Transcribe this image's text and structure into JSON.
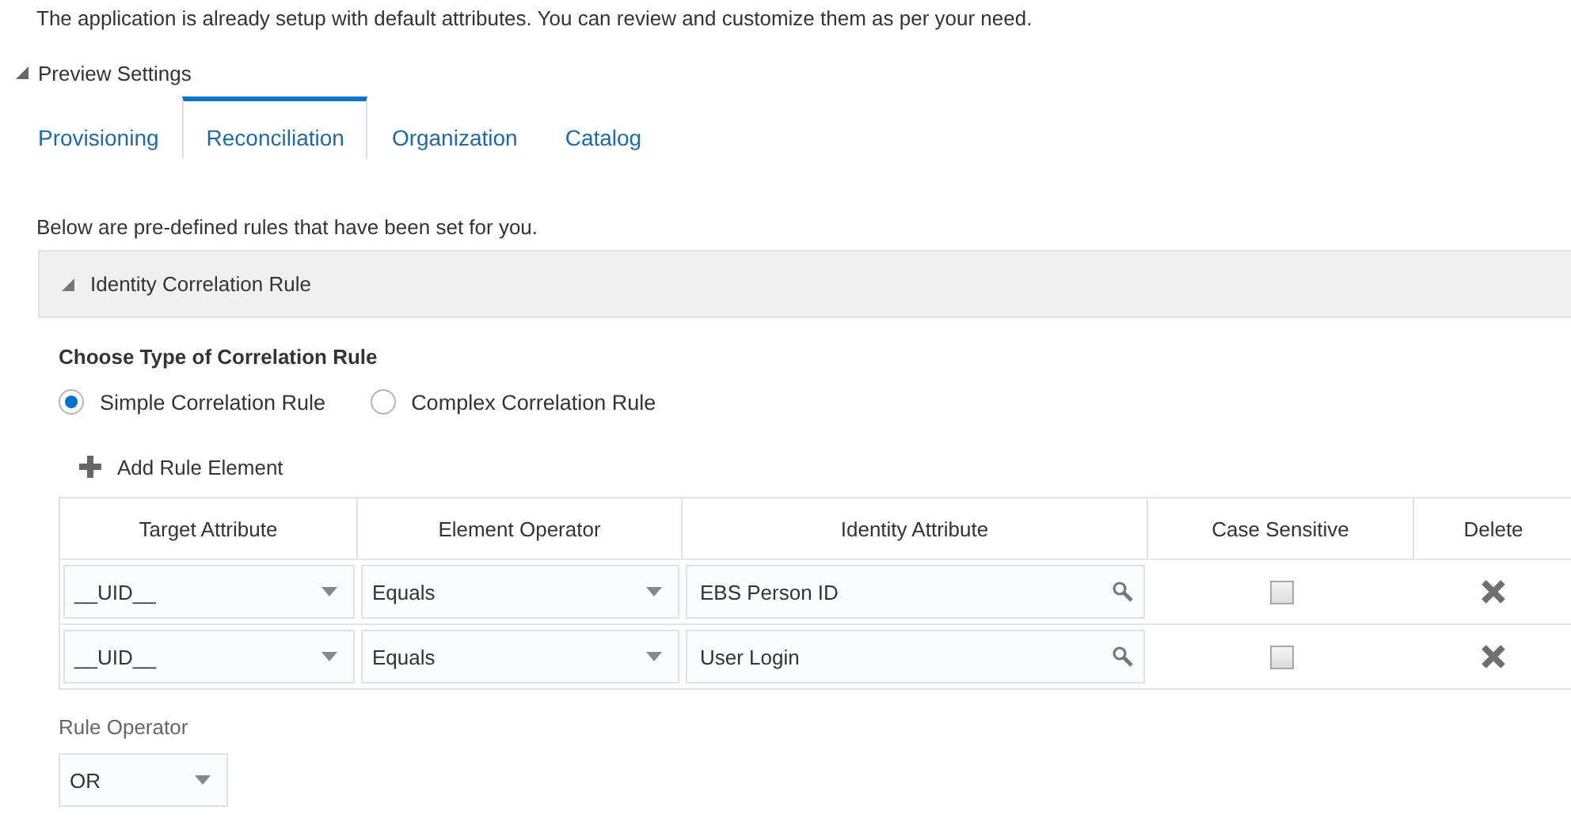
{
  "intro": "The application is already setup with default attributes. You can review and customize them as per your need.",
  "preview_settings": {
    "label": "Preview Settings",
    "expanded": true
  },
  "tabs": [
    {
      "label": "Provisioning",
      "selected": false
    },
    {
      "label": "Reconciliation",
      "selected": true
    },
    {
      "label": "Organization",
      "selected": false
    },
    {
      "label": "Catalog",
      "selected": false
    }
  ],
  "description": "Below are pre-defined rules that have been set for you.",
  "section": {
    "title": "Identity Correlation Rule",
    "expanded": true
  },
  "rule_type": {
    "label": "Choose Type of Correlation Rule",
    "options": [
      {
        "label": "Simple Correlation Rule",
        "selected": true
      },
      {
        "label": "Complex Correlation Rule",
        "selected": false
      }
    ]
  },
  "add_button": "Add Rule Element",
  "table": {
    "columns": [
      "Target Attribute",
      "Element Operator",
      "Identity Attribute",
      "Case Sensitive",
      "Delete"
    ],
    "rows": [
      {
        "target": "__UID__",
        "operator": "Equals",
        "identity": "EBS Person ID",
        "case_sensitive": false
      },
      {
        "target": "__UID__",
        "operator": "Equals",
        "identity": "User Login",
        "case_sensitive": false
      }
    ]
  },
  "rule_operator": {
    "label": "Rule Operator",
    "value": "OR"
  }
}
